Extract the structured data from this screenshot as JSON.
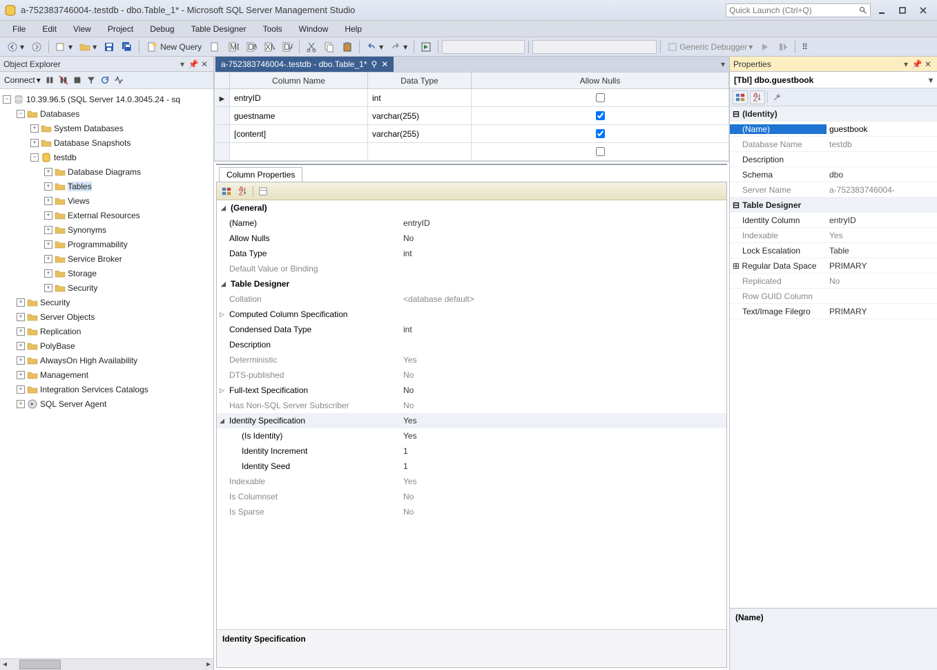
{
  "titlebar": {
    "title": "a-752383746004-.testdb - dbo.Table_1* - Microsoft SQL Server Management Studio",
    "quick_launch_placeholder": "Quick Launch (Ctrl+Q)"
  },
  "menubar": [
    "File",
    "Edit",
    "View",
    "Project",
    "Debug",
    "Table Designer",
    "Tools",
    "Window",
    "Help"
  ],
  "toolbar": {
    "new_query": "New Query",
    "generic_debugger": "Generic Debugger"
  },
  "object_explorer": {
    "title": "Object Explorer",
    "connect_label": "Connect",
    "server": "10.39.96.5 (SQL Server 14.0.3045.24 - sq",
    "nodes": {
      "databases": "Databases",
      "system_databases": "System Databases",
      "database_snapshots": "Database Snapshots",
      "testdb": "testdb",
      "database_diagrams": "Database Diagrams",
      "tables": "Tables",
      "views": "Views",
      "external_resources": "External Resources",
      "synonyms": "Synonyms",
      "programmability": "Programmability",
      "service_broker": "Service Broker",
      "storage": "Storage",
      "security_db": "Security",
      "security": "Security",
      "server_objects": "Server Objects",
      "replication": "Replication",
      "polybase": "PolyBase",
      "always_on": "AlwaysOn High Availability",
      "management": "Management",
      "integration_services": "Integration Services Catalogs",
      "sql_server_agent": "SQL Server Agent"
    }
  },
  "doc_tab": "a-752383746004-.testdb - dbo.Table_1*",
  "designer": {
    "headers": {
      "name": "Column Name",
      "type": "Data Type",
      "nulls": "Allow Nulls"
    },
    "rows": [
      {
        "name": "entryID",
        "type": "int",
        "nulls": false,
        "active": true
      },
      {
        "name": "guestname",
        "type": "varchar(255)",
        "nulls": true,
        "active": false
      },
      {
        "name": "[content]",
        "type": "varchar(255)",
        "nulls": true,
        "active": false
      }
    ]
  },
  "column_properties": {
    "tab": "Column Properties",
    "footer_title": "Identity Specification",
    "groups": {
      "general": "(General)",
      "designer": "Table Designer"
    },
    "items": {
      "name_k": "(Name)",
      "name_v": "entryID",
      "allow_nulls_k": "Allow Nulls",
      "allow_nulls_v": "No",
      "data_type_k": "Data Type",
      "data_type_v": "int",
      "default_k": "Default Value or Binding",
      "default_v": "",
      "collation_k": "Collation",
      "collation_v": "<database default>",
      "computed_k": "Computed Column Specification",
      "computed_v": "",
      "condensed_k": "Condensed Data Type",
      "condensed_v": "int",
      "description_k": "Description",
      "description_v": "",
      "deterministic_k": "Deterministic",
      "deterministic_v": "Yes",
      "dts_k": "DTS-published",
      "dts_v": "No",
      "fts_k": "Full-text Specification",
      "fts_v": "No",
      "nonsql_k": "Has Non-SQL Server Subscriber",
      "nonsql_v": "No",
      "idspec_k": "Identity Specification",
      "idspec_v": "Yes",
      "isid_k": "(Is Identity)",
      "isid_v": "Yes",
      "idinc_k": "Identity Increment",
      "idinc_v": "1",
      "idseed_k": "Identity Seed",
      "idseed_v": "1",
      "indexable_k": "Indexable",
      "indexable_v": "Yes",
      "colset_k": "Is Columnset",
      "colset_v": "No",
      "sparse_k": "Is Sparse",
      "sparse_v": "No"
    }
  },
  "properties": {
    "title": "Properties",
    "object": "[Tbl] dbo.guestbook",
    "desc_label": "(Name)",
    "groups": {
      "identity": "(Identity)",
      "designer": "Table Designer"
    },
    "rows": {
      "name_k": "(Name)",
      "name_v": "guestbook",
      "dbname_k": "Database Name",
      "dbname_v": "testdb",
      "desc_k": "Description",
      "desc_v": "",
      "schema_k": "Schema",
      "schema_v": "dbo",
      "server_k": "Server Name",
      "server_v": "a-752383746004-",
      "idcol_k": "Identity Column",
      "idcol_v": "entryID",
      "indexable_k": "Indexable",
      "indexable_v": "Yes",
      "lock_k": "Lock Escalation",
      "lock_v": "Table",
      "regdata_k": "Regular Data Space",
      "regdata_v": "PRIMARY",
      "repl_k": "Replicated",
      "repl_v": "No",
      "rowguid_k": "Row GUID Column",
      "rowguid_v": "",
      "textimg_k": "Text/Image Filegro",
      "textimg_v": "PRIMARY"
    }
  }
}
